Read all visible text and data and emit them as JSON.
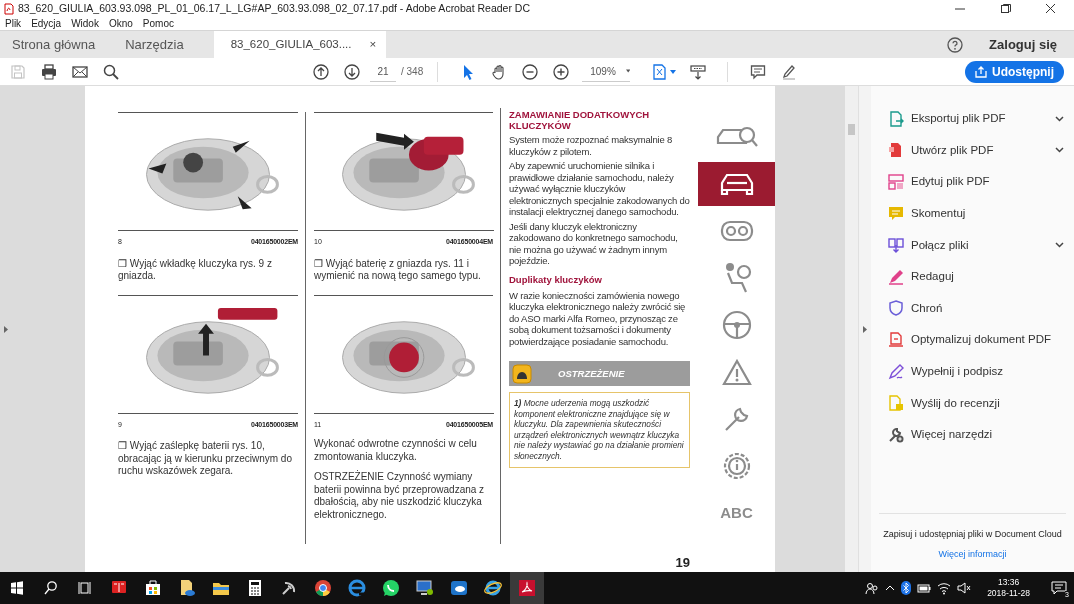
{
  "window": {
    "title": "83_620_GIULIA_603.93.098_PL_01_06.17_L_LG#AP_603.93.098_02_07.17.pdf - Adobe Acrobat Reader DC"
  },
  "menu": [
    "Plik",
    "Edycja",
    "Widok",
    "Okno",
    "Pomoc"
  ],
  "tabs": [
    {
      "label": "Strona główna",
      "selected": false
    },
    {
      "label": "Narzędzia",
      "selected": false
    },
    {
      "label": "83_620_GIULIA_603....",
      "selected": true,
      "close": "×"
    }
  ],
  "account": {
    "label": "Zaloguj się"
  },
  "toolbar": {
    "left_tools": [
      {
        "kind": "save",
        "disabled": true
      },
      {
        "kind": "print",
        "disabled": false
      },
      {
        "kind": "mail",
        "disabled": false
      },
      {
        "kind": "search",
        "disabled": false
      }
    ],
    "nav_tools": [
      {
        "kind": "prev"
      },
      {
        "kind": "next"
      }
    ],
    "page": {
      "value": "21",
      "total": "/ 348"
    },
    "pointer_tools": [
      {
        "kind": "cursor",
        "selected": true
      },
      {
        "kind": "hand",
        "selected": false
      }
    ],
    "zoom_tools": [
      {
        "kind": "zoom_out"
      },
      {
        "kind": "zoom_in"
      }
    ],
    "zoom": {
      "value": "109%"
    },
    "view_tools": [
      {
        "kind": "fit"
      },
      {
        "kind": "scroll"
      }
    ],
    "markup_tools": [
      {
        "kind": "comment"
      },
      {
        "kind": "highlight"
      }
    ],
    "share": {
      "label": "Udostępnij"
    }
  },
  "document": {
    "columns": [
      [
        {
          "kind": "figure",
          "number": "8",
          "code": "0401650002EM"
        },
        {
          "kind": "step",
          "text": "❒ Wyjąć wkładkę kluczyka rys. 9 z gniazda."
        },
        {
          "kind": "figure",
          "number": "9",
          "code": "0401650003EM"
        },
        {
          "kind": "step",
          "text": "❒ Wyjąć zaślepkę baterii rys. 10, obracając ją w kierunku przeciwnym do ruchu wskazówek zegara."
        }
      ],
      [
        {
          "kind": "figure",
          "number": "10",
          "code": "0401650004EM"
        },
        {
          "kind": "step",
          "text": "❒ Wyjąć baterię z gniazda rys. 11 i wymienić na nową tego samego typu."
        },
        {
          "kind": "figure",
          "number": "11",
          "code": "0401650005EM"
        },
        {
          "kind": "paragraph",
          "text": "Wykonać odwrotne czynności w celu zmontowania kluczyka."
        },
        {
          "kind": "paragraph",
          "text": "OSTRZEŻENIE Czynność wymiany baterii powinna być przeprowadzana z dbałością, aby nie uszkodzić kluczyka elektronicznego."
        }
      ],
      [
        {
          "kind": "heading",
          "text": "ZAMAWIANIE DODATKOWYCH KLUCZYKÓW"
        },
        {
          "kind": "paragraph",
          "text": "System może rozpoznać maksymalnie 8 kluczyków z pilotem."
        },
        {
          "kind": "paragraph",
          "text": "Aby zapewnić uruchomienie silnika i prawidłowe działanie samochodu, należy używać wyłącznie kluczyków elektronicznych specjalnie zakodowanych do instalacji elektrycznej danego samochodu."
        },
        {
          "kind": "paragraph",
          "text": "Jeśli dany kluczyk elektroniczny zakodowano do konkretnego samochodu, nie można go używać w żadnym innym pojeździe."
        },
        {
          "kind": "subheading",
          "text": "Duplikaty kluczyków"
        },
        {
          "kind": "paragraph",
          "text": "W razie konieczności zamówienia nowego kluczyka elektronicznego należy zwrócić się do ASO marki Alfa Romeo, przynosząc ze sobą dokument tożsamości i dokumenty potwierdzające posiadanie samochodu."
        },
        {
          "kind": "warning",
          "text": "OSTRZEŻENIE"
        },
        {
          "kind": "note",
          "text": "**1)** Mocne uderzenia mogą uszkodzić komponent elektroniczne znajdujące się w kluczyku. Dla zapewnienia skuteczności urządzeń elektronicznych wewnątrz kluczyka nie należy wystawiać go na działanie promieni słonecznych."
        }
      ]
    ],
    "page_number": "19",
    "chapter_tabs": [
      {
        "kind": "car_search",
        "selected": false
      },
      {
        "kind": "car",
        "selected": true
      },
      {
        "kind": "dashboard",
        "selected": false
      },
      {
        "kind": "seat",
        "selected": false
      },
      {
        "kind": "steering",
        "selected": false
      },
      {
        "kind": "warning",
        "selected": false
      },
      {
        "kind": "wrench",
        "selected": false
      },
      {
        "kind": "info",
        "selected": false
      },
      {
        "kind": "text",
        "label": "ABC",
        "selected": false
      }
    ]
  },
  "tools_panel": {
    "tools": [
      {
        "kind": "export",
        "label": "Eksportuj plik PDF",
        "expandable": true
      },
      {
        "kind": "create",
        "label": "Utwórz plik PDF",
        "expandable": true
      },
      {
        "kind": "edit",
        "label": "Edytuj plik PDF",
        "expandable": false
      },
      {
        "kind": "comment",
        "label": "Skomentuj",
        "expandable": false
      },
      {
        "kind": "combine",
        "label": "Połącz pliki",
        "expandable": true
      },
      {
        "kind": "redact",
        "label": "Redaguj",
        "expandable": false
      },
      {
        "kind": "protect",
        "label": "Chroń",
        "expandable": false
      },
      {
        "kind": "optimize",
        "label": "Optymalizuj dokument PDF",
        "expandable": false
      },
      {
        "kind": "sign",
        "label": "Wypełnij i podpisz",
        "expandable": false
      },
      {
        "kind": "review",
        "label": "Wyślij do recenzji",
        "expandable": false
      },
      {
        "kind": "more",
        "label": "Więcej narzędzi",
        "expandable": false
      }
    ],
    "promo": {
      "text": "Zapisuj i udostępniaj pliki w Document Cloud",
      "link": "Więcej informacji"
    }
  },
  "taskbar": {
    "apps": [
      {
        "kind": "book",
        "active": false
      },
      {
        "kind": "store",
        "active": false
      },
      {
        "kind": "people",
        "active": false
      },
      {
        "kind": "folder",
        "active": false
      },
      {
        "kind": "calculator",
        "active": false
      },
      {
        "kind": "satellite",
        "active": false
      },
      {
        "kind": "chrome",
        "active": false
      },
      {
        "kind": "edge",
        "active": false
      },
      {
        "kind": "whatsapp",
        "active": false
      },
      {
        "kind": "monitor",
        "active": false
      },
      {
        "kind": "cloud",
        "active": false
      },
      {
        "kind": "ie",
        "active": false
      },
      {
        "kind": "acrobat",
        "active": true
      }
    ],
    "time": "13:36",
    "date": "2018-11-28",
    "notifications": "3"
  }
}
